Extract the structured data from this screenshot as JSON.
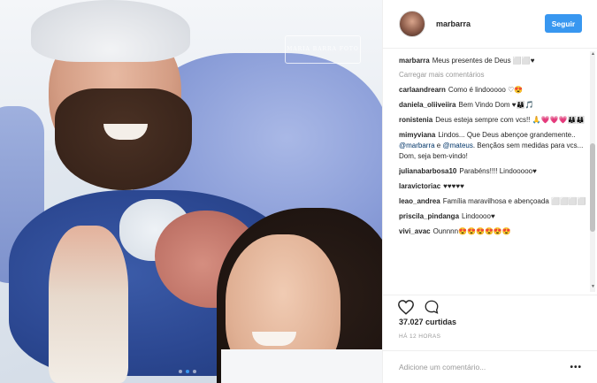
{
  "post": {
    "author": "marbarra",
    "follow_label": "Seguir",
    "watermark": "MARIA BARRA FOTO"
  },
  "comments": {
    "caption": {
      "user": "marbarra",
      "text": "Meus presentes de Deus ⬜⬜♥"
    },
    "load_more": "Carregar mais comentários",
    "items": [
      {
        "user": "carlaandrearn",
        "text": "Como é lindooooo ♡😍"
      },
      {
        "user": "daniela_oliiveiira",
        "text": "Bem Vindo Dom ♥👨‍👩‍👦🎵"
      },
      {
        "user": "ronistenia",
        "text": "Deus esteja sempre com vcs!! 🙏💗💗💗👨‍👩‍👦👨‍👩‍👦"
      },
      {
        "user": "mimyviana",
        "text_before": "Lindos... Que Deus abençoe grandemente.. ",
        "mention1": "@marbarra",
        "text_mid": " e ",
        "mention2": "@mateus",
        "text_after": ". Bençãos sem medidas para vcs... Dom, seja bem-vindo!"
      },
      {
        "user": "julianabarbosa10",
        "text": "Parabéns!!!! Lindooooo♥"
      },
      {
        "user": "laravictoriac",
        "text": "♥♥♥♥♥"
      },
      {
        "user": "leao_andrea",
        "text": "Família maravilhosa e abençoada ⬜⬜⬜⬜"
      },
      {
        "user": "priscila_pindanga",
        "text": "Lindoooo♥"
      },
      {
        "user": "vivi_avac",
        "text": "Ounnnn😍😍😍😍😍😍"
      }
    ]
  },
  "stats": {
    "likes": "37.027 curtidas",
    "time": "HÁ 12 HORAS"
  },
  "add_comment": {
    "placeholder": "Adicione um comentário...",
    "more": "•••"
  },
  "colors": {
    "accent": "#3897f0",
    "muted": "#999999",
    "text": "#262626"
  },
  "icons": [
    "heart-icon",
    "comment-icon",
    "more-icon"
  ],
  "carousel": {
    "count": 3,
    "active_index": 1
  }
}
